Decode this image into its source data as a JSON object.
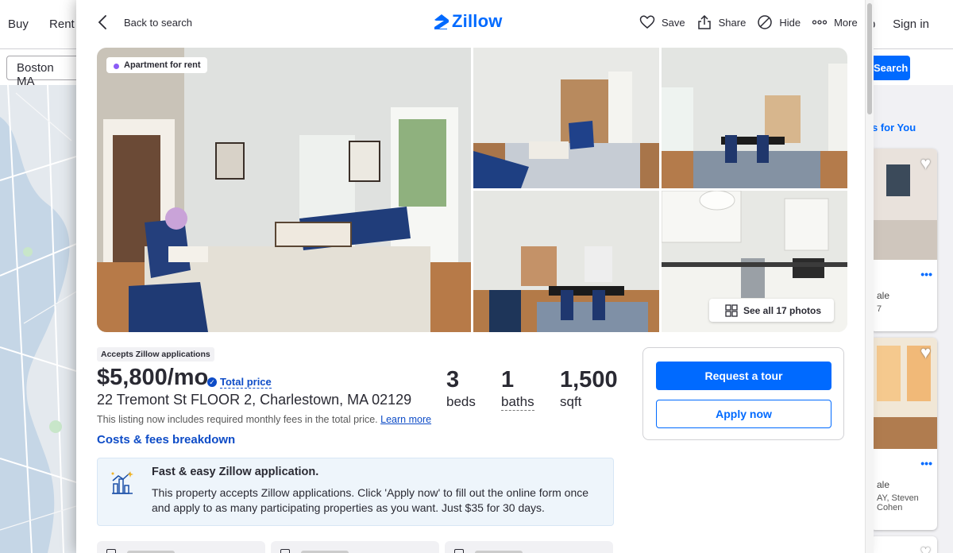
{
  "background": {
    "nav_left": [
      "Buy",
      "Rent"
    ],
    "nav_help": "p",
    "nav_right": "Sign in",
    "search_value": "Boston MA",
    "search_button": "Search",
    "for_you": "s for You",
    "card1_text": "ale",
    "card1_sub": "7",
    "card2_text": "ale",
    "card2_sub": "AY, Steven Cohen"
  },
  "header": {
    "back_label": "Back to search",
    "logo_text": "Zillow",
    "actions": {
      "save": "Save",
      "share": "Share",
      "hide": "Hide",
      "more": "More"
    }
  },
  "gallery": {
    "listing_type": "Apartment for rent",
    "see_all_label": "See all 17 photos"
  },
  "listing": {
    "accepts_badge": "Accepts Zillow applications",
    "price": "$5,800/mo",
    "total_price_label": "Total price",
    "address": "22 Tremont St FLOOR 2, Charlestown, MA 02129",
    "fee_note": "This listing now includes required monthly fees in the total price.",
    "learn_more": "Learn more",
    "costs_link": "Costs & fees breakdown",
    "stats": {
      "beds_value": "3",
      "beds_label": "beds",
      "baths_value": "1",
      "baths_label": "baths",
      "sqft_value": "1,500",
      "sqft_label": "sqft"
    }
  },
  "cta": {
    "request_tour": "Request a tour",
    "apply_now": "Apply now"
  },
  "application_box": {
    "title": "Fast & easy Zillow application.",
    "body": "This property accepts Zillow applications. Click 'Apply now' to fill out the online form once and apply to as many participating properties as you want. Just $35 for 30 days."
  },
  "colors": {
    "brand_blue": "#006aff",
    "link_blue": "#0e4cc7",
    "listing_type_dot": "#8b5cf6"
  }
}
